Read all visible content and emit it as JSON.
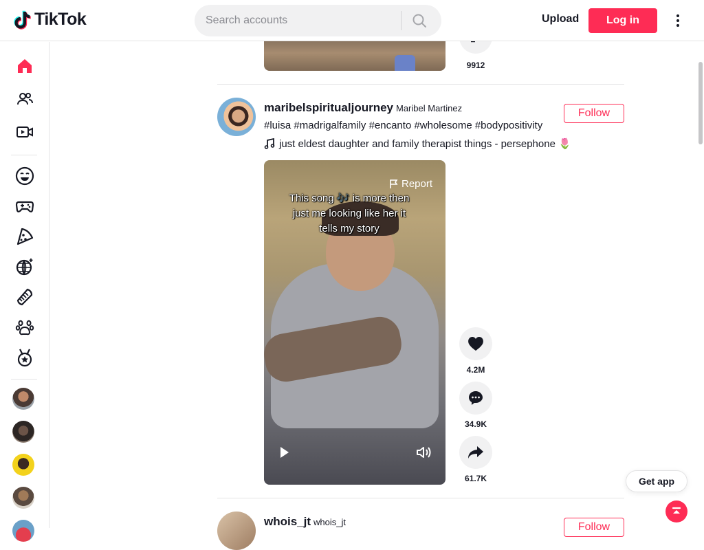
{
  "header": {
    "logo_text": "TikTok",
    "search_placeholder": "Search accounts",
    "upload_label": "Upload",
    "login_label": "Log in"
  },
  "sidebar": {
    "nav": [
      "home-icon",
      "following-icon",
      "live-icon"
    ],
    "categories": [
      "comedy-icon",
      "gaming-icon",
      "food-icon",
      "dance-icon",
      "beauty-icon",
      "animals-icon",
      "sports-icon"
    ],
    "accounts": [
      "account-1",
      "account-2",
      "account-3",
      "account-4",
      "account-5"
    ]
  },
  "previous_post": {
    "share_count": "9912"
  },
  "post": {
    "username": "maribelspiritualjourney",
    "nickname": "Maribel Martinez",
    "follow_label": "Follow",
    "caption": "#luisa #madrigalfamily #encanto #wholesome #bodypositivity",
    "music": "just eldest daughter and family therapist things - persephone 🌷",
    "report_label": "Report",
    "overlay_text_1": "This song 🎶 is more then",
    "overlay_text_2": "just me looking like her it",
    "overlay_text_3": "tells my story",
    "likes": "4.2M",
    "comments": "34.9K",
    "shares": "61.7K"
  },
  "next_post": {
    "username": "whois_jt",
    "nickname": "whois_jt",
    "follow_label": "Follow"
  },
  "floating": {
    "get_app_label": "Get app"
  },
  "colors": {
    "brand": "#fe2c55",
    "text": "#161823",
    "divider": "#e3e3e4"
  }
}
